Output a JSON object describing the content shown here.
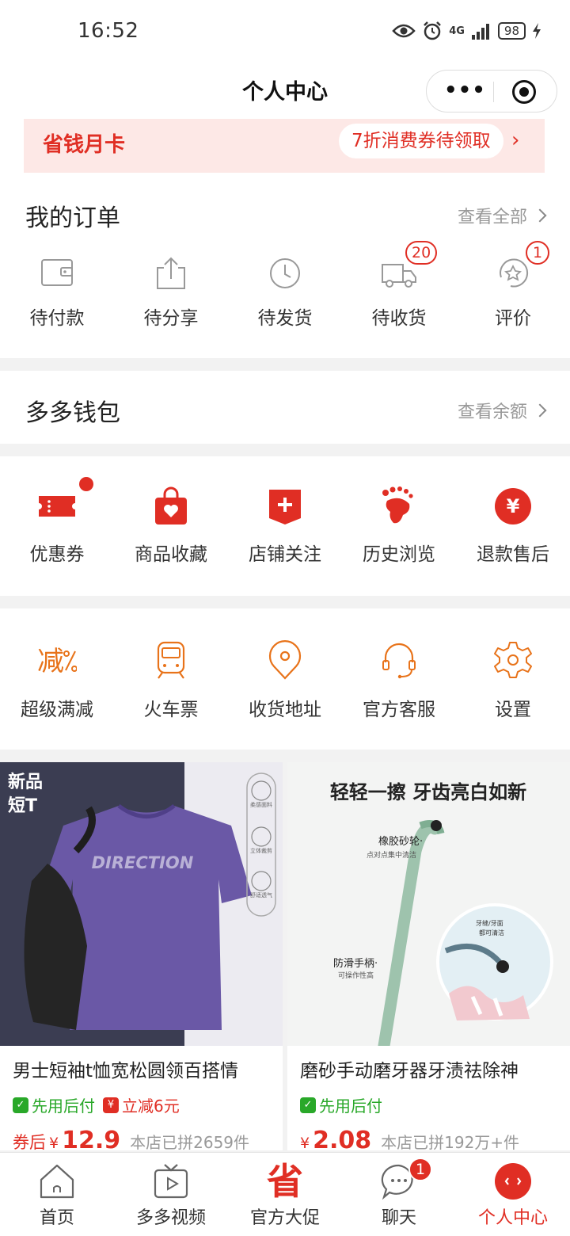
{
  "status_bar": {
    "time": "16:52",
    "network": "4G",
    "battery": "98"
  },
  "nav": {
    "title": "个人中心",
    "menu_icon": "more-dots-icon",
    "close_icon": "target-icon"
  },
  "savings_card": {
    "label": "省钱月卡",
    "promo": "7折消费券待领取"
  },
  "orders": {
    "title": "我的订单",
    "view_all": "查看全部",
    "items": [
      {
        "label": "待付款",
        "icon": "wallet-icon",
        "badge": ""
      },
      {
        "label": "待分享",
        "icon": "share-icon",
        "badge": ""
      },
      {
        "label": "待发货",
        "icon": "clock-icon",
        "badge": ""
      },
      {
        "label": "待收货",
        "icon": "truck-icon",
        "badge": "20"
      },
      {
        "label": "评价",
        "icon": "review-icon",
        "badge": "1"
      }
    ]
  },
  "wallet": {
    "title": "多多钱包",
    "link": "查看余额"
  },
  "shortcuts": [
    {
      "label": "优惠券",
      "icon": "coupon-icon"
    },
    {
      "label": "商品收藏",
      "icon": "favorite-bag-icon"
    },
    {
      "label": "店铺关注",
      "icon": "shop-follow-icon"
    },
    {
      "label": "历史浏览",
      "icon": "footprint-icon"
    },
    {
      "label": "退款售后",
      "icon": "refund-icon"
    }
  ],
  "services": [
    {
      "label": "超级满减",
      "icon": "discount-icon"
    },
    {
      "label": "火车票",
      "icon": "train-icon"
    },
    {
      "label": "收货地址",
      "icon": "location-icon"
    },
    {
      "label": "官方客服",
      "icon": "headset-icon"
    },
    {
      "label": "设置",
      "icon": "gear-icon"
    }
  ],
  "products": [
    {
      "badge": "新品短T",
      "print": "DIRECTION",
      "features": [
        "柔感面料",
        "立体裁剪",
        "舒适透气"
      ],
      "name": "男士短袖t恤宽松圆领百搭情",
      "tags": [
        {
          "text": "先用后付",
          "type": "green"
        },
        {
          "text": "立减6元",
          "type": "red"
        }
      ],
      "price_prefix": "券后",
      "price": "12.9",
      "sold": "本店已拼2659件"
    },
    {
      "headline": "轻轻一擦 牙齿亮白如新",
      "callout_1_title": "橡胶砂轮·",
      "callout_1_sub": "点对点集中清洁",
      "callout_2_title": "防滑手柄·",
      "callout_2_sub": "可操作性高",
      "callout_3": "牙缝/牙面都可清洁",
      "name": "磨砂手动磨牙器牙渍祛除神",
      "tags": [
        {
          "text": "先用后付",
          "type": "green"
        }
      ],
      "price_prefix": "",
      "price": "2.08",
      "sold": "本店已拼192万+件"
    }
  ],
  "tabbar": [
    {
      "label": "首页",
      "icon": "home-icon",
      "active": false
    },
    {
      "label": "多多视频",
      "icon": "video-icon",
      "active": false
    },
    {
      "label": "官方大促",
      "icon": "sheng-icon",
      "glyph": "省",
      "active": false
    },
    {
      "label": "聊天",
      "icon": "chat-icon",
      "active": false,
      "badge": "1"
    },
    {
      "label": "个人中心",
      "icon": "profile-icon",
      "active": true
    }
  ],
  "colors": {
    "brand_red": "#e02e24",
    "orange": "#e8731a",
    "green": "#29a829"
  }
}
